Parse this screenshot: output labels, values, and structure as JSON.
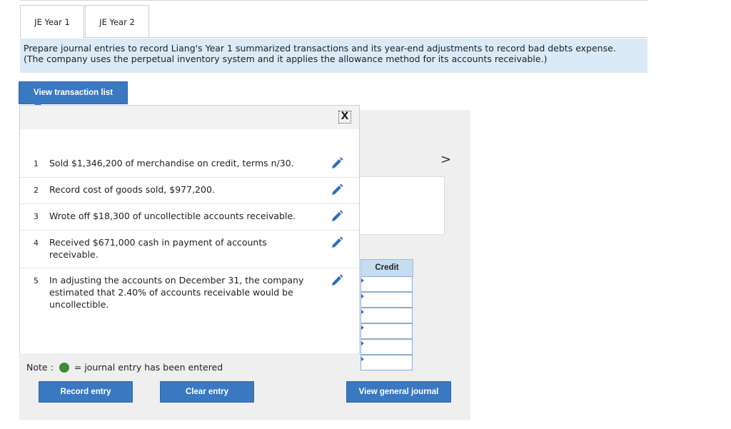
{
  "tabs": [
    {
      "label": "JE Year 1"
    },
    {
      "label": "JE Year 2"
    }
  ],
  "instructions": {
    "line1": "Prepare journal entries to record Liang's Year 1 summarized transactions and its year-end adjustments to record bad debts expense.",
    "line2": "(The company uses the perpetual inventory system and it applies the allowance method for its accounts receivable.)"
  },
  "buttons": {
    "view_transaction_list": "View transaction list",
    "record_entry": "Record entry",
    "clear_entry": "Clear entry",
    "view_general_journal": "View general journal"
  },
  "popup": {
    "close_glyph": "X",
    "transactions": [
      {
        "num": "1",
        "text": "Sold $1,346,200 of merchandise on credit, terms n/30."
      },
      {
        "num": "2",
        "text": "Record cost of goods sold, $977,200."
      },
      {
        "num": "3",
        "text": "Wrote off $18,300 of uncollectible accounts receivable."
      },
      {
        "num": "4",
        "text": "Received $671,000 cash in payment of accounts receivable."
      },
      {
        "num": "5",
        "text": "In adjusting the accounts on December 31, the company estimated that 2.40% of accounts receivable would be uncollectible."
      }
    ]
  },
  "note": {
    "prefix": "Note :",
    "suffix": "= journal entry has been entered"
  },
  "journal": {
    "credit_header": "Credit",
    "next_chevron": ">"
  },
  "colors": {
    "accent": "#3a78c2",
    "instructions_bg": "#dbeaf7",
    "entered_dot": "#3d8a3d"
  }
}
